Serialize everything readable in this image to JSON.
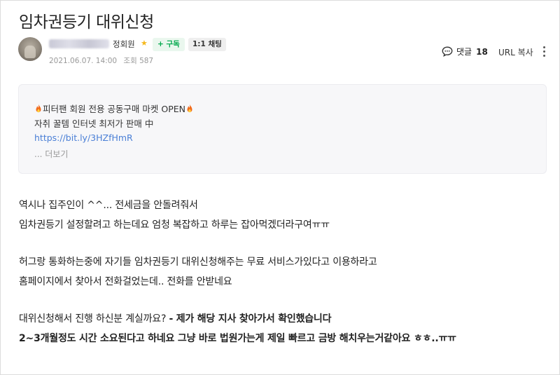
{
  "post": {
    "title": "임차권등기 대위신청",
    "author_grade": "정회원",
    "subscribe_label": "+ 구독",
    "chat_label": "1:1 채팅",
    "date": "2021.06.07. 14:00",
    "views_label": "조회 587",
    "comments_label": "댓글",
    "comments_count": "18",
    "url_copy_label": "URL 복사"
  },
  "notice": {
    "line1": "피터팬 회원 전용 공동구매 마켓 OPEN",
    "line2": "자취 꿀템 인터넷 최저가 판매 中",
    "link": "https://bit.ly/3HZfHmR",
    "more": "... 더보기"
  },
  "body": {
    "p1_line1": "역시나 집주인이 ^^... 전세금을 안돌려줘서",
    "p1_line2": "임차권등기 설정할려고 하는데요 엄청 복잡하고 하루는 잡아먹겠더라구여ㅠㅠ",
    "p2_line1": "허그랑 통화하는중에 자기들 임차권등기 대위신청해주는 무료 서비스가있다고 이용하라고",
    "p2_line2": "홈페이지에서 찾아서 전화걸었는데.. 전화를 안받네요",
    "p3_line1_normal": "대위신청해서 진행 하신분 계실까요? ",
    "p3_line1_bold": "- 제가 해당 지사 찾아가서 확인했습니다",
    "p3_line2": "2~3개월정도 시간 소요된다고 하네요 그냥 바로 법원가는게 제일 빠르고 금방 해치우는거같아요 ㅎㅎ..ㅠㅠ"
  },
  "colors": {
    "subscribe_green": "#03a94d",
    "link_blue": "#4a7fd6",
    "star_yellow": "#f5b81c"
  }
}
